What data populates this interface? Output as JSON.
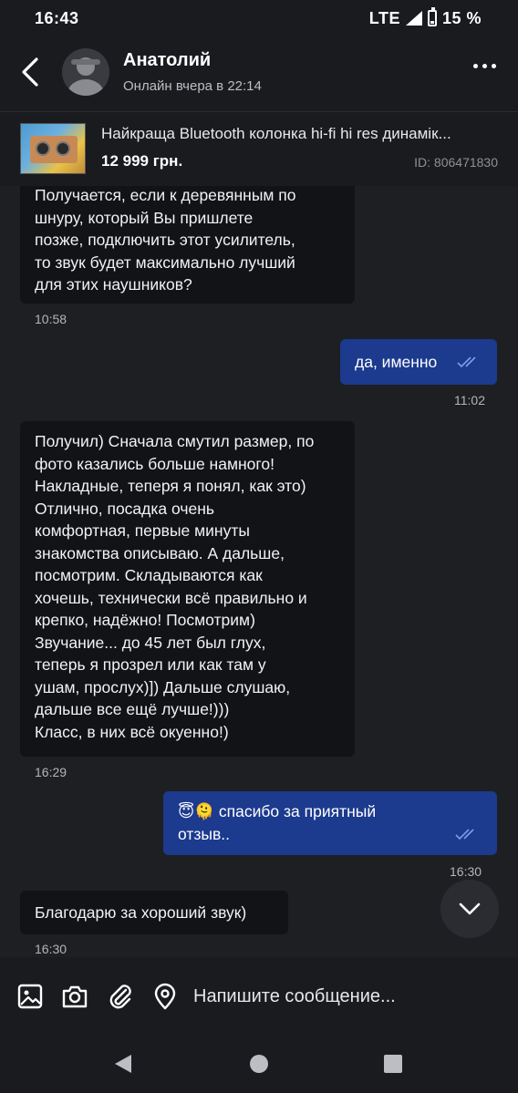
{
  "status_bar": {
    "time": "16:43",
    "network": "LTE",
    "battery": "15 %"
  },
  "header": {
    "contact_name": "Анатолий",
    "contact_status": "Онлайн вчера в 22:14"
  },
  "product": {
    "title": "Найкраща Bluetooth колонка hi-fi hi res динамік...",
    "price": "12 999 грн.",
    "id_label": "ID: 806471830"
  },
  "messages": [
    {
      "direction": "incoming",
      "lines": [
        "Получается, если к деревянным по",
        "шнуру, который Вы пришлете",
        "позже, подключить этот усилитель,",
        "то звук будет максимально лучший",
        "для этих наушников?"
      ],
      "time": "10:58"
    },
    {
      "direction": "outgoing",
      "lines": [
        "да, именно"
      ],
      "time": "11:02",
      "read": true
    },
    {
      "direction": "incoming",
      "lines": [
        "Получил) Сначала смутил размер, по",
        "фото казались больше намного!",
        "Накладные, теперя я понял, как это)",
        "Отлично, посадка очень",
        "комфортная, первые минуты",
        "знакомства описываю. А дальше,",
        "посмотрим. Складываются как",
        "хочешь, технически всё правильно и",
        "крепко, надёжно! Посмотрим)",
        "Звучание... до 45 лет был глух,",
        "теперь я прозрел или как там у",
        "ушам, прослух)]) Дальше слушаю,",
        "дальше все ещё лучше!)))",
        "Класс, в них всё окуенно!)"
      ],
      "time": "16:29"
    },
    {
      "direction": "outgoing",
      "lines": [
        "😇🫠 спасибо за приятный",
        "отзыв.."
      ],
      "time": "16:30",
      "read": true
    },
    {
      "direction": "incoming",
      "lines": [
        "Благодарю за хороший звук)"
      ],
      "time": "16:30"
    }
  ],
  "composer": {
    "placeholder": "Напишите сообщение..."
  },
  "icons": [
    "back-arrow-icon",
    "more-icon",
    "image-icon",
    "camera-icon",
    "paperclip-icon",
    "location-icon",
    "chevron-down-icon",
    "double-check-icon",
    "nav-back-icon",
    "nav-home-icon",
    "nav-recents-icon"
  ],
  "colors": {
    "background": "#1e1f23",
    "incoming_bubble": "#121317",
    "outgoing_bubble": "#1c3a8e",
    "read_check": "#7f9de8"
  }
}
